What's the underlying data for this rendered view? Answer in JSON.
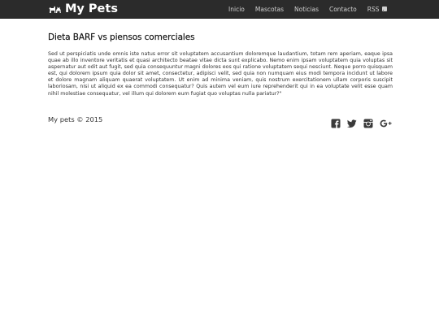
{
  "navbar": {
    "brand": "My Pets",
    "items": [
      {
        "label": "Inicio"
      },
      {
        "label": "Mascotas"
      },
      {
        "label": "Noticias"
      },
      {
        "label": "Contacto"
      },
      {
        "label": "RSS"
      }
    ]
  },
  "article": {
    "title": "Dieta BARF vs piensos comerciales",
    "body": "Sed ut perspiciatis unde omnis iste natus error sit voluptatem accusantium doloremque laudantium, totam rem aperiam, eaque ipsa quae ab illo inventore veritatis et quasi architecto beatae vitae dicta sunt explicabo. Nemo enim ipsam voluptatem quia voluptas sit aspernatur aut odit aut fugit, sed quia consequuntur magni dolores eos qui ratione voluptatem sequi nesciunt. Neque porro quisquam est, qui dolorem ipsum quia dolor sit amet, consectetur, adipisci velit, sed quia non numquam eius modi tempora incidunt ut labore et dolore magnam aliquam quaerat voluptatem. Ut enim ad minima veniam, quis nostrum exercitationem ullam corporis suscipit laboriosam, nisi ut aliquid ex ea commodi consequatur? Quis autem vel eum iure reprehenderit qui in ea voluptate velit esse quam nihil molestiae consequatur, vel illum qui dolorem eum fugiat quo voluptas nulla pariatur?\""
  },
  "footer": {
    "copyright": "My pets © 2015",
    "social": [
      "facebook-icon",
      "twitter-icon",
      "instagram-icon",
      "google-plus-icon"
    ]
  },
  "colors": {
    "navbar_bg": "#2b2b2b",
    "nav_text": "#d0d0d0",
    "brand_text": "#ffffff"
  }
}
